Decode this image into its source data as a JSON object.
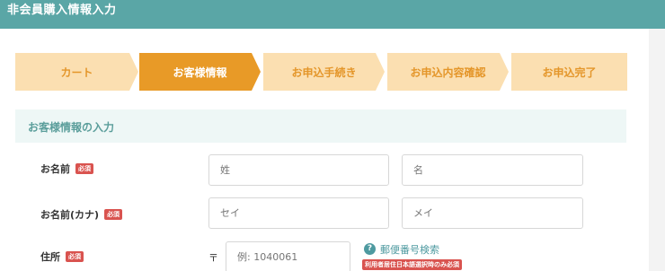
{
  "header": {
    "title": "非会員購入情報入力"
  },
  "steps": [
    {
      "label": "カート",
      "active": false
    },
    {
      "label": "お客様情報",
      "active": true
    },
    {
      "label": "お申込手続き",
      "active": false
    },
    {
      "label": "お申込内容確認",
      "active": false
    },
    {
      "label": "お申込完了",
      "active": false
    }
  ],
  "section": {
    "title": "お客様情報の入力"
  },
  "form": {
    "name": {
      "label": "お名前",
      "required_badge": "必須",
      "last_placeholder": "姓",
      "first_placeholder": "名"
    },
    "name_kana": {
      "label": "お名前(カナ)",
      "required_badge": "必須",
      "last_placeholder": "セイ",
      "first_placeholder": "メイ"
    },
    "address": {
      "label": "住所",
      "required_badge": "必須",
      "postal_mark": "〒",
      "postal_placeholder": "例: 1040061",
      "zip_search_label": "郵便番号検索",
      "zip_search_icon": "question-circle-icon",
      "note": "利用者居住日本語選択時のみ必須"
    }
  },
  "colors": {
    "header_bg": "#5aa6a6",
    "step_active": "#e89a27",
    "step_inactive": "#fbdfb1",
    "step_inactive_text": "#e4962a",
    "section_bg": "#eef7f6",
    "required_badge": "#d9534f",
    "link": "#4e9aa0"
  }
}
